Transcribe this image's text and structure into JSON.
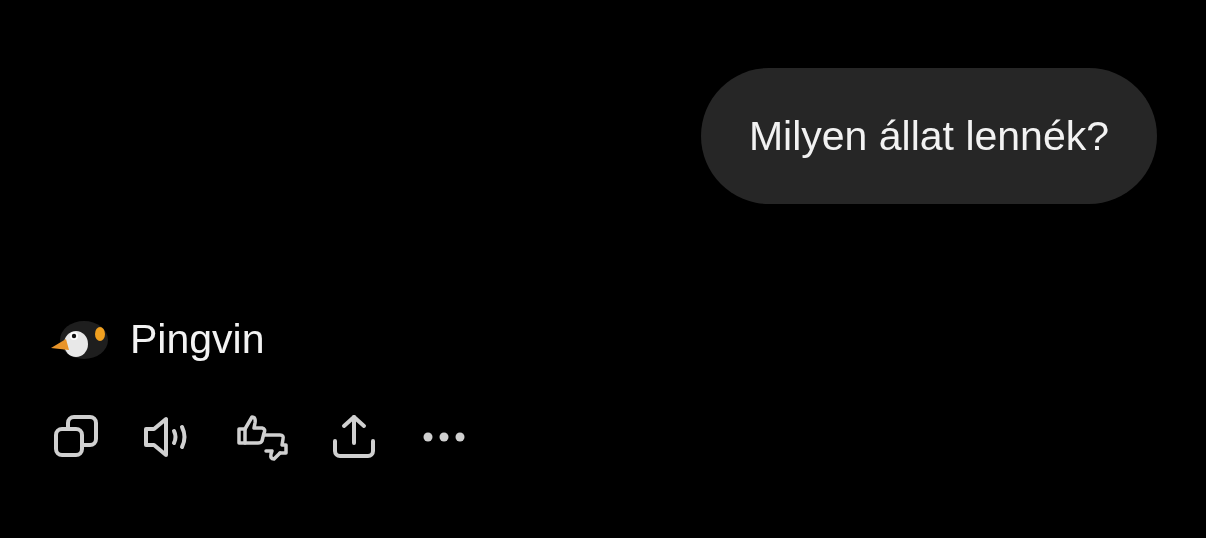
{
  "user_message": {
    "text": "Milyen állat lennék?"
  },
  "reply": {
    "text": "Pingvin"
  },
  "actions": [
    {
      "kind": "copy"
    },
    {
      "kind": "speaker"
    },
    {
      "kind": "feedback"
    },
    {
      "kind": "share"
    },
    {
      "kind": "more"
    }
  ]
}
